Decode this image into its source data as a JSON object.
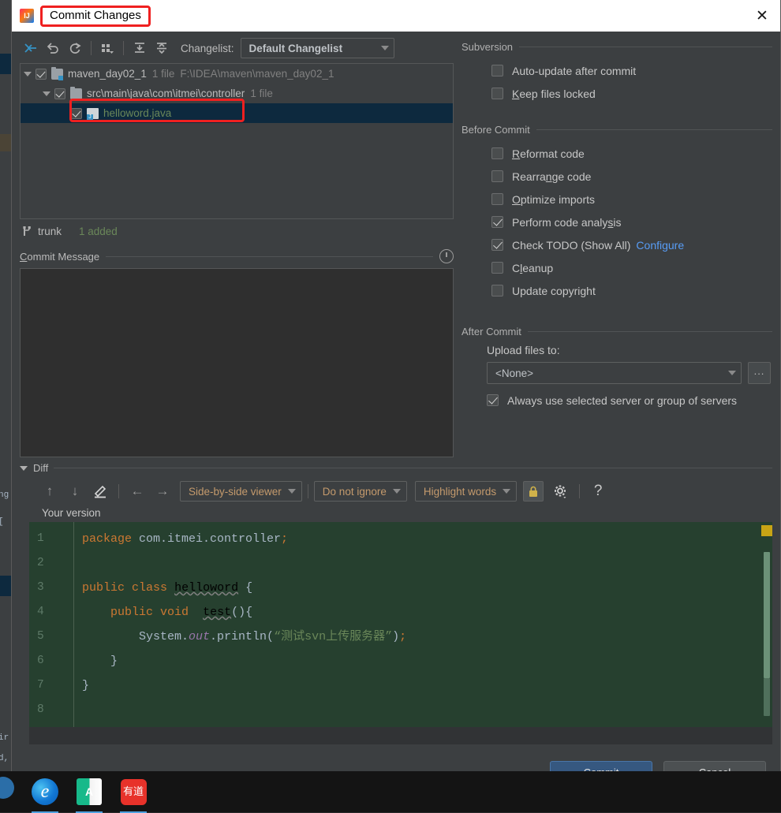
{
  "window": {
    "title": "Commit Changes",
    "app_icon": "intellij-idea-icon",
    "close_label": "✕"
  },
  "toolbar": {
    "icons": [
      {
        "name": "move-to-another-changelist-icon",
        "glyph": "→"
      },
      {
        "name": "rollback-icon",
        "glyph": "↶"
      },
      {
        "name": "refresh-icon",
        "glyph": "↻"
      },
      {
        "name": "group-by-icon",
        "glyph": "∷"
      },
      {
        "name": "expand-all-icon",
        "glyph": "⤓"
      },
      {
        "name": "collapse-all-icon",
        "glyph": "⤒"
      }
    ],
    "changelist_label": "Changelist:",
    "changelist_value": "Default Changelist"
  },
  "tree": {
    "rows": [
      {
        "name": "maven_day02_1",
        "meta": "1 file",
        "path": "F:\\IDEA\\maven\\maven_day02_1",
        "checked": true,
        "expanded": true,
        "icon": "module-folder-icon",
        "depth": 1,
        "selected": false,
        "green": false
      },
      {
        "name": "src\\main\\java\\com\\itmei\\controller",
        "meta": "1 file",
        "path": "",
        "checked": true,
        "expanded": true,
        "icon": "folder-icon",
        "depth": 2,
        "selected": false,
        "green": false
      },
      {
        "name": "helloword.java",
        "meta": "",
        "path": "",
        "checked": true,
        "expanded": false,
        "icon": "java-file-icon",
        "depth": 3,
        "selected": true,
        "green": true
      }
    ]
  },
  "branch": {
    "icon": "branch-icon",
    "name": "trunk",
    "status": "1 added"
  },
  "commit_message": {
    "label": "Commit Message",
    "label_mnemonic": "C",
    "value": "",
    "history_icon": "clock-history-icon"
  },
  "subversion": {
    "title": "Subversion",
    "options": [
      {
        "label": "Auto-update after commit",
        "checked": false,
        "mnemonic": ""
      },
      {
        "label": "Keep files locked",
        "checked": false,
        "mnemonic": "K"
      }
    ]
  },
  "before_commit": {
    "title": "Before Commit",
    "options": [
      {
        "label": "Reformat code",
        "checked": false,
        "mnemonic": "R",
        "link": ""
      },
      {
        "label": "Rearrange code",
        "checked": false,
        "mnemonic": "n",
        "link": ""
      },
      {
        "label": "Optimize imports",
        "checked": false,
        "mnemonic": "O",
        "link": ""
      },
      {
        "label": "Perform code analysis",
        "checked": true,
        "mnemonic": "s",
        "link": ""
      },
      {
        "label": "Check TODO (Show All)",
        "checked": true,
        "mnemonic": "",
        "link": "Configure"
      },
      {
        "label": "Cleanup",
        "checked": false,
        "mnemonic": "l",
        "link": ""
      },
      {
        "label": "Update copyright",
        "checked": false,
        "mnemonic": "",
        "link": ""
      }
    ]
  },
  "after_commit": {
    "title": "After Commit",
    "upload_label": "Upload files to:",
    "upload_value": "<None>",
    "browse_label": "...",
    "always_use": {
      "label": "Always use selected server or group of servers",
      "checked": true
    }
  },
  "diff": {
    "title": "Diff",
    "expanded": true,
    "buttons": [
      {
        "name": "previous-difference-icon",
        "glyph": "↑"
      },
      {
        "name": "next-difference-icon",
        "glyph": "↓"
      },
      {
        "name": "edit-source-icon",
        "glyph": "✎"
      },
      {
        "name": "apply-left-icon",
        "glyph": "←"
      },
      {
        "name": "apply-right-icon",
        "glyph": "→"
      }
    ],
    "viewer_mode": "Side-by-side viewer",
    "ignore_mode": "Do not ignore",
    "highlight_mode": "Highlight words",
    "lock_icon": "lock-icon",
    "settings_icon": "gear-icon",
    "help_icon": "help-icon",
    "pane_title": "Your version"
  },
  "editor": {
    "line_numbers": [
      "1",
      "2",
      "3",
      "4",
      "5",
      "6",
      "7",
      "8"
    ],
    "lines": [
      [
        {
          "t": "package",
          "c": "kw"
        },
        {
          "t": " com.itmei.controller",
          "c": "plain"
        },
        {
          "t": ";",
          "c": "semi"
        }
      ],
      [],
      [
        {
          "t": "public",
          "c": "kw"
        },
        {
          "t": " ",
          "c": "plain"
        },
        {
          "t": "class",
          "c": "kw"
        },
        {
          "t": " ",
          "c": "plain"
        },
        {
          "t": "helloword",
          "c": "wavy"
        },
        {
          "t": " {",
          "c": "plain"
        }
      ],
      [
        {
          "t": "    ",
          "c": "plain"
        },
        {
          "t": "public",
          "c": "kw"
        },
        {
          "t": " ",
          "c": "plain"
        },
        {
          "t": "void",
          "c": "kw"
        },
        {
          "t": "  ",
          "c": "plain"
        },
        {
          "t": "test",
          "c": "wavy"
        },
        {
          "t": "(){",
          "c": "plain"
        }
      ],
      [
        {
          "t": "        System.",
          "c": "plain"
        },
        {
          "t": "out",
          "c": "field"
        },
        {
          "t": ".println(",
          "c": "plain"
        },
        {
          "t": "“测试svn上传服务器”",
          "c": "str"
        },
        {
          "t": ")",
          "c": "plain"
        },
        {
          "t": ";",
          "c": "semi"
        }
      ],
      [
        {
          "t": "    }",
          "c": "plain"
        }
      ],
      [
        {
          "t": "}",
          "c": "plain"
        }
      ],
      []
    ]
  },
  "footer": {
    "commit_label": "Commit",
    "cancel_label": "Cancel"
  },
  "taskbar": {
    "items": [
      {
        "name": "edge-browser-icon",
        "glyph": "e"
      },
      {
        "name": "translator-icon",
        "glyph": "A"
      },
      {
        "name": "youdao-dict-icon",
        "glyph": "有道"
      }
    ]
  },
  "colors": {
    "dialog_bg": "#3c3f41",
    "selection_blue": "#0d293e",
    "accent_link": "#589df6",
    "highlight_red": "#ef2020",
    "added_green": "#6a8759",
    "editor_bg": "#26402f",
    "keyword_orange": "#cc7832",
    "button_blue": "#365880"
  }
}
